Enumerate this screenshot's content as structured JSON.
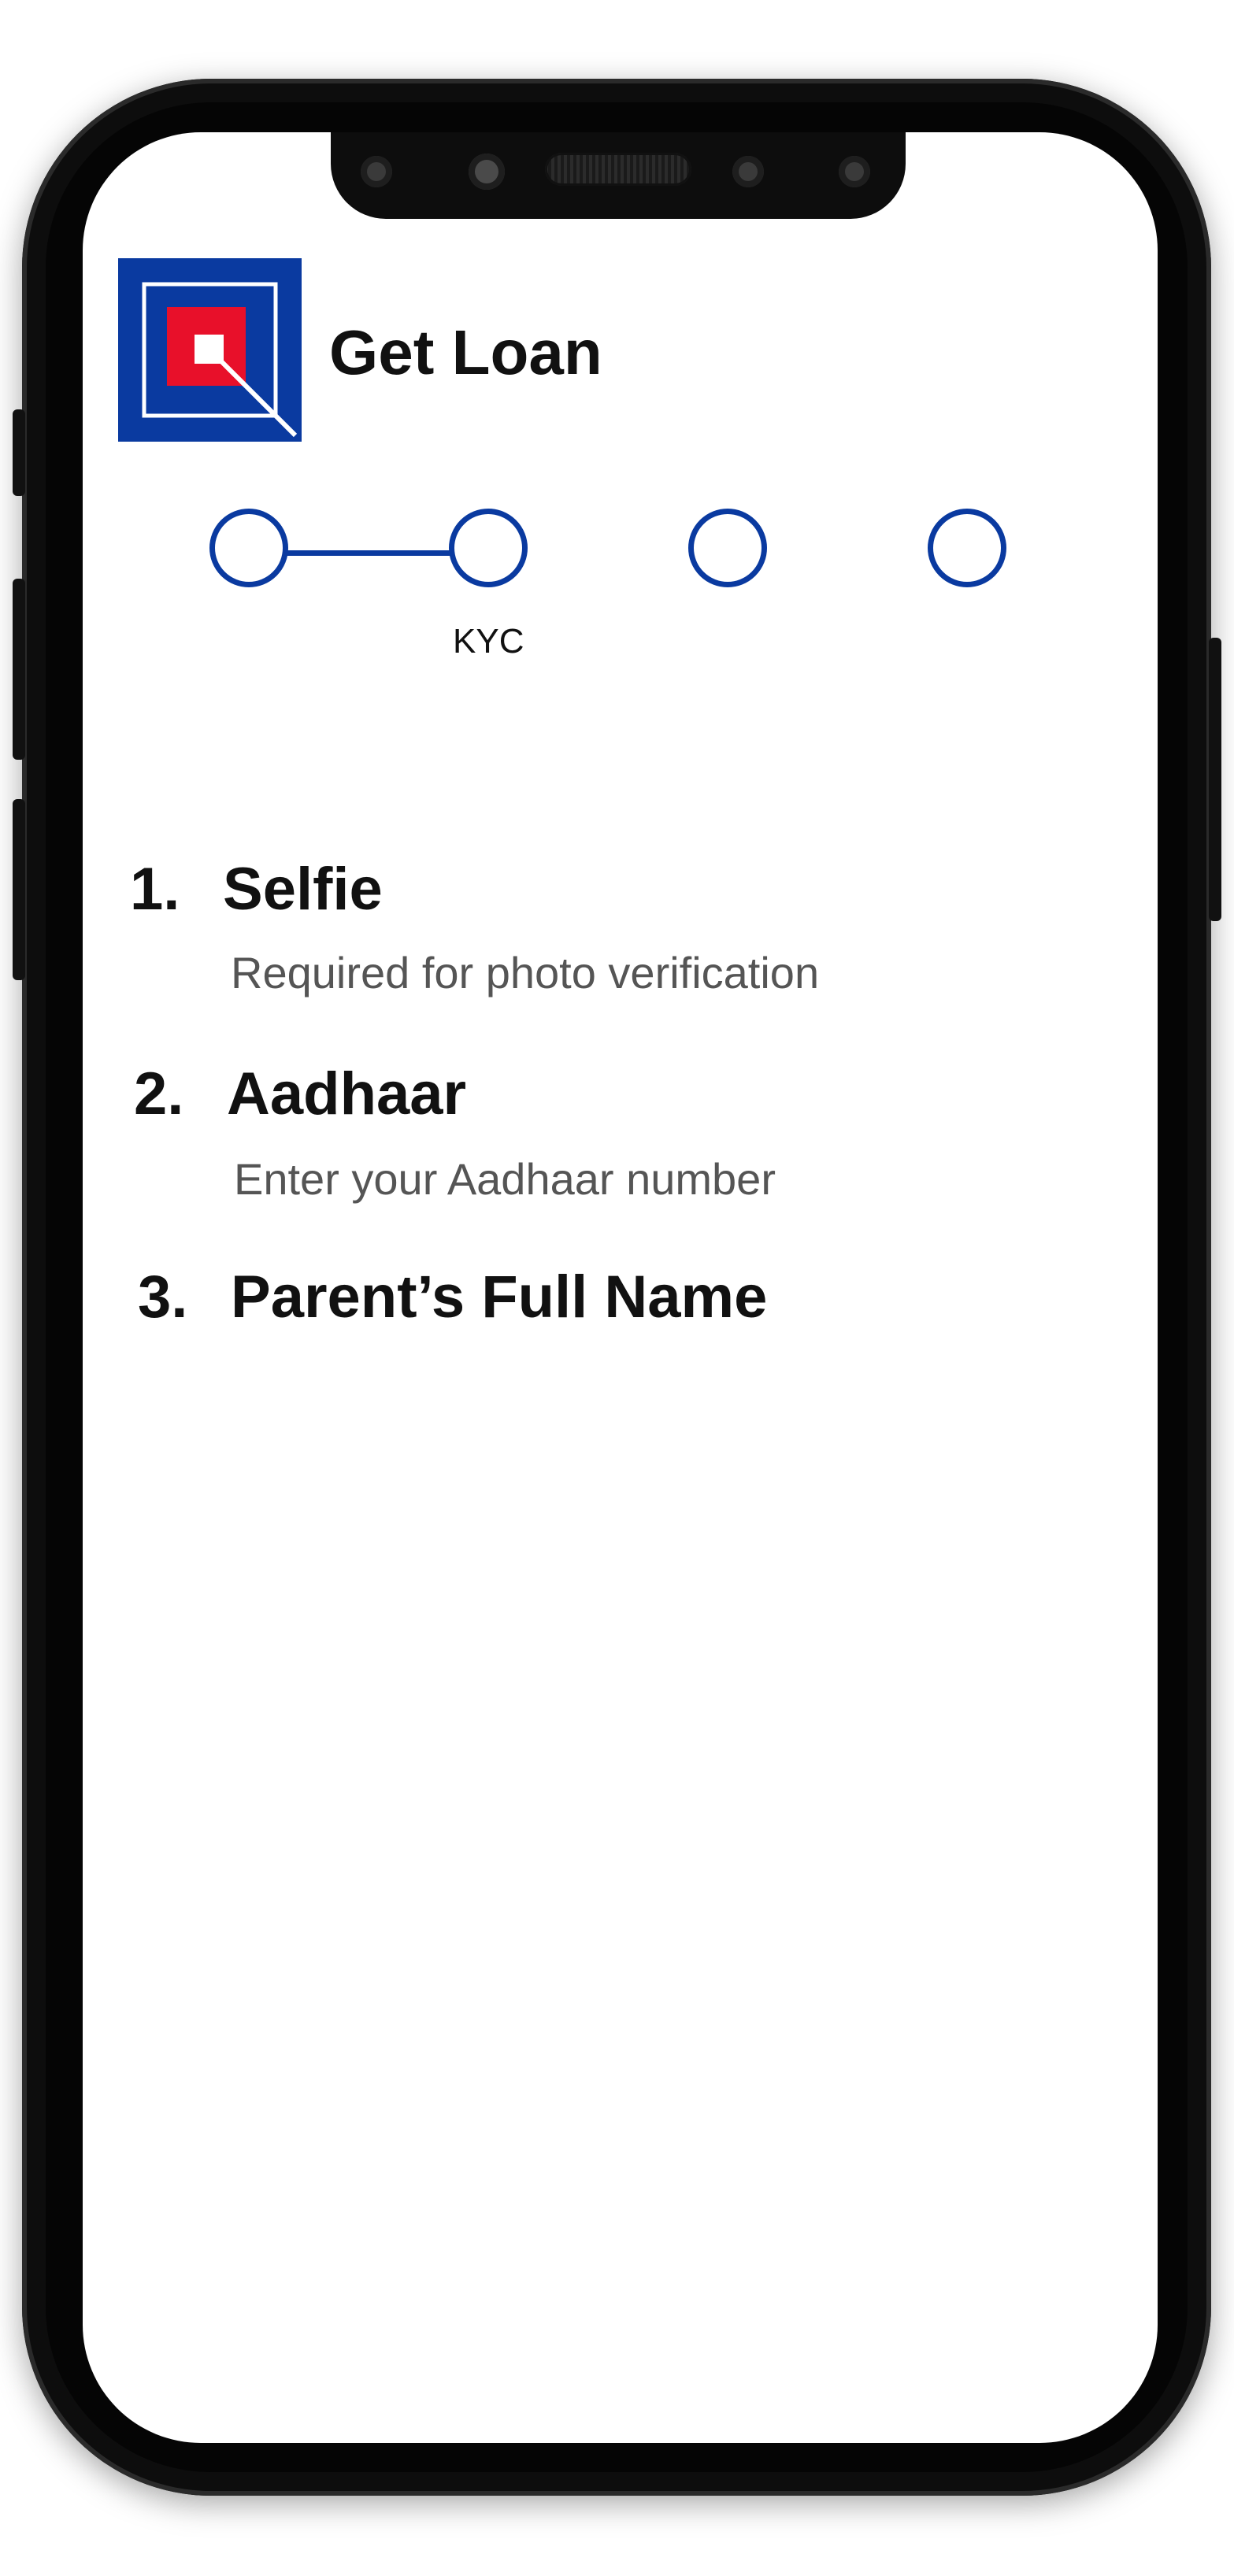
{
  "header": {
    "title": "Get Loan",
    "logo_icon": "bank-logo-icon"
  },
  "stepper": {
    "active_label": "KYC",
    "steps_total": 4,
    "color": "#0a3aa0"
  },
  "kyc_items": [
    {
      "number": "1.",
      "title": "Selfie",
      "subtitle": "Required for photo verification"
    },
    {
      "number": "2.",
      "title": "Aadhaar",
      "subtitle": "Enter your Aadhaar number"
    },
    {
      "number": "3.",
      "title": "Parent’s Full Name"
    }
  ],
  "colors": {
    "logo_blue": "#0a3aa0",
    "logo_red": "#e8102a",
    "text_primary": "#111111",
    "text_secondary": "#555555"
  }
}
